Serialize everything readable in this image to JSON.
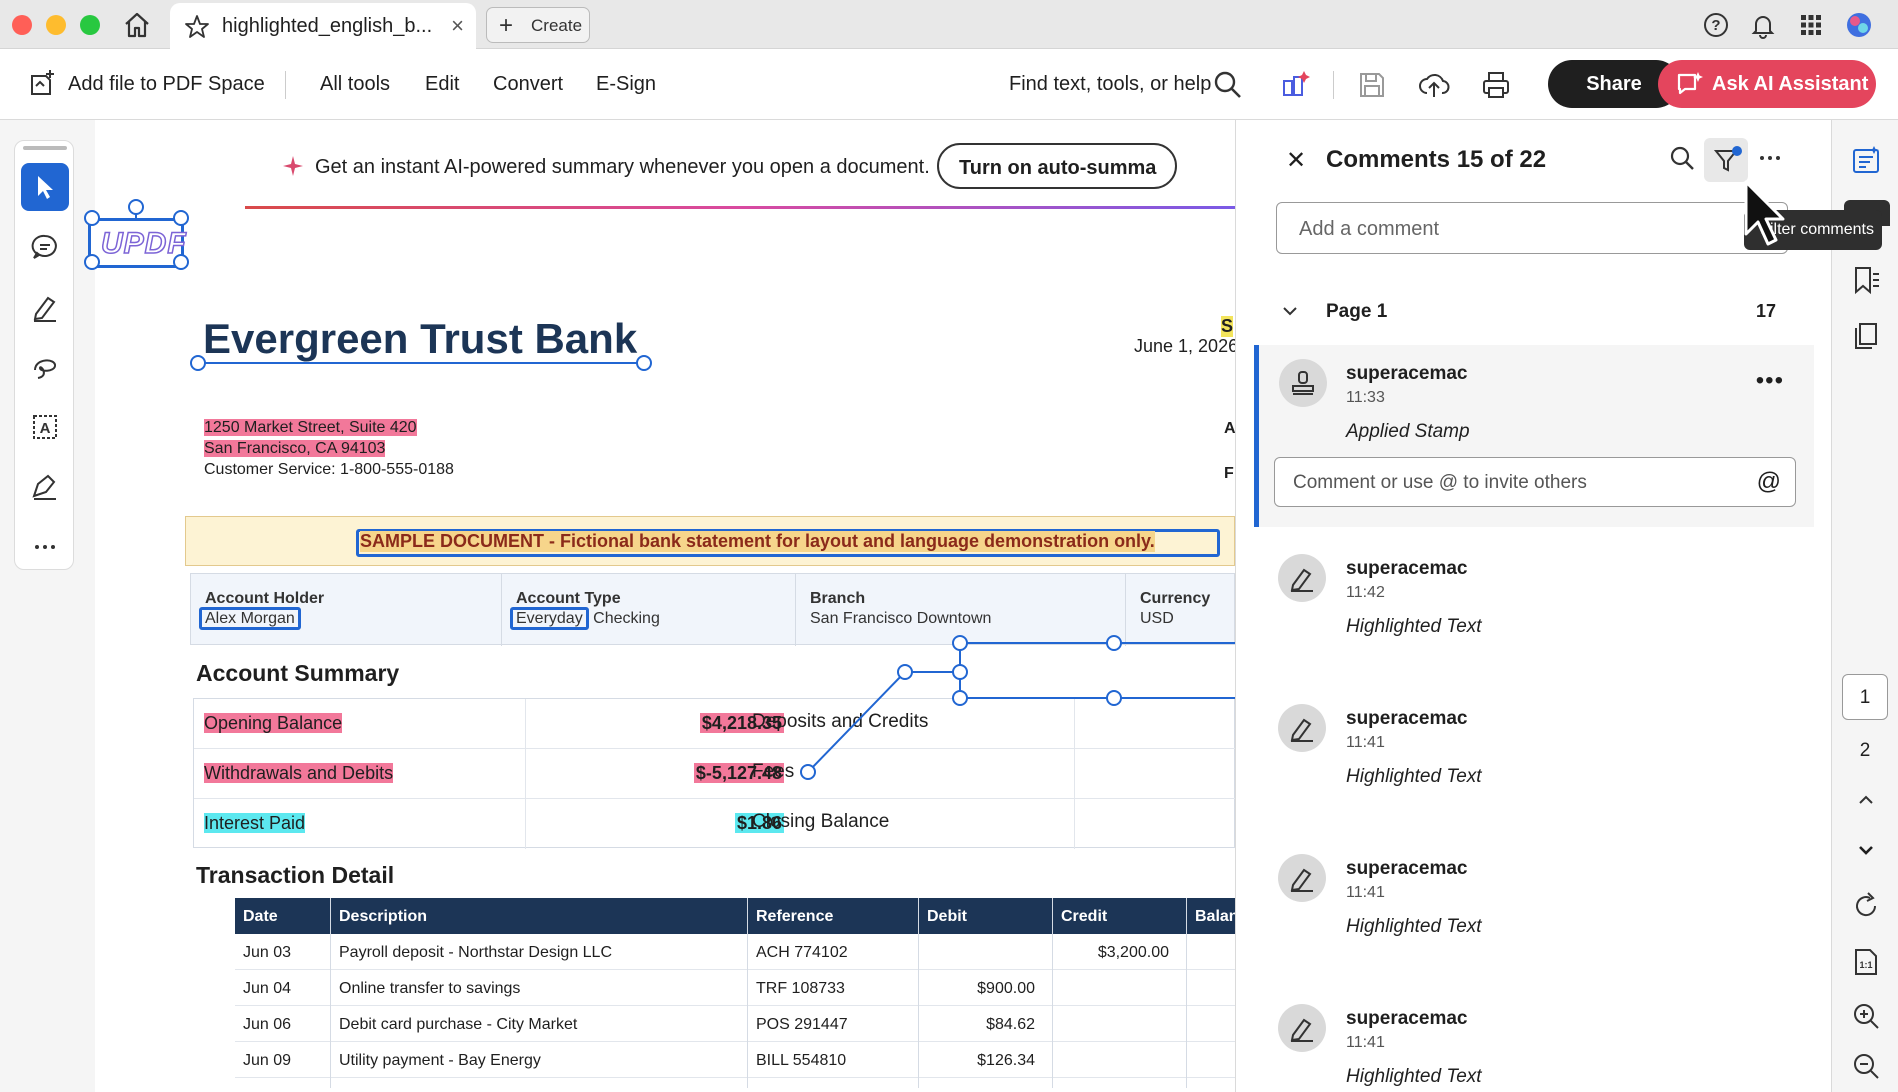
{
  "window": {
    "tab_title": "highlighted_english_b...",
    "tab_close": "×",
    "create_label": "Create"
  },
  "toolbar": {
    "add_file": "Add file to PDF Space",
    "all_tools": "All tools",
    "edit": "Edit",
    "convert": "Convert",
    "esign": "E-Sign",
    "find": "Find text, tools, or help",
    "share": "Share",
    "ask_ai": "Ask AI Assistant"
  },
  "banner": {
    "text": "Get an instant AI-powered summary whenever you open a document.",
    "button": "Turn on auto-summa"
  },
  "document": {
    "logo_text": "UPDF",
    "bank_name": "Evergreen Trust Bank",
    "date": "June 1, 2026",
    "stamp_letter": "S",
    "side_letter_a": "A",
    "side_letter_b": "F",
    "address_line1": "1250 Market Street, Suite 420",
    "address_line2": "San Francisco, CA 94103",
    "customer_service": "Customer Service: 1-800-555-0188",
    "sample_notice": "SAMPLE DOCUMENT - Fictional bank statement for layout and language demonstration only.",
    "account": {
      "holder_label": "Account Holder",
      "holder_value": "Alex Morgan",
      "type_label": "Account Type",
      "type_value_a": "Everyday",
      "type_value_b": " Checking",
      "branch_label": "Branch",
      "branch_value": "San Francisco Downtown",
      "currency_label": "Currency",
      "currency_value": "USD"
    },
    "summary_title": "Account Summary",
    "summary": [
      {
        "label": "Opening Balance",
        "amount": "$4,218.35",
        "right_label": "Deposits and Credits"
      },
      {
        "label": "Withdrawals and Debits",
        "amount": "$-5,127.48",
        "right_label": "Fees"
      },
      {
        "label": "Interest Paid",
        "amount": "$1.86",
        "right_label": "Closing Balance"
      }
    ],
    "transactions_title": "Transaction Detail",
    "tx_headers": [
      "Date",
      "Description",
      "Reference",
      "Debit",
      "Credit",
      "Balan"
    ],
    "transactions": [
      {
        "date": "Jun 03",
        "desc": "Payroll deposit - Northstar Design LLC",
        "ref": "ACH 774102",
        "debit": "",
        "credit": "$3,200.00"
      },
      {
        "date": "Jun 04",
        "desc": "Online transfer to savings",
        "ref": "TRF 108733",
        "debit": "$900.00",
        "credit": ""
      },
      {
        "date": "Jun 06",
        "desc": "Debit card purchase - City Market",
        "ref": "POS 291447",
        "debit": "$84.62",
        "credit": ""
      },
      {
        "date": "Jun 09",
        "desc": "Utility payment - Bay Energy",
        "ref": "BILL 554810",
        "debit": "$126.34",
        "credit": ""
      }
    ]
  },
  "comments_panel": {
    "title": "Comments 15 of 22",
    "add_placeholder": "Add a comment",
    "tooltip": "Filter comments",
    "page_label": "Page 1",
    "page_count": "17",
    "reply_placeholder": "Comment or use @ to invite others",
    "comments": [
      {
        "user": "superacemac",
        "time": "11:33",
        "action": "Applied Stamp"
      },
      {
        "user": "superacemac",
        "time": "11:42",
        "action": "Highlighted Text"
      },
      {
        "user": "superacemac",
        "time": "11:41",
        "action": "Highlighted Text"
      },
      {
        "user": "superacemac",
        "time": "11:41",
        "action": "Highlighted Text"
      },
      {
        "user": "superacemac",
        "time": "11:41",
        "action": "Highlighted Text"
      }
    ]
  },
  "right_rail": {
    "page_current": "1",
    "page_next": "2"
  },
  "colors": {
    "accent": "#2166d2",
    "ai_button": "#e4455d",
    "highlight_pink": "#f2789a",
    "highlight_cyan": "#5ce8ef",
    "table_header": "#1c3556"
  }
}
